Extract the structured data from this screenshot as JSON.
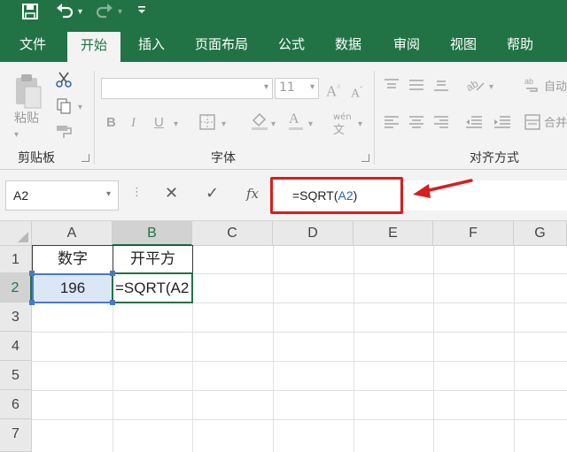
{
  "quick_access": {
    "save_icon": "save-icon",
    "undo_icon": "undo-icon",
    "redo_icon": "redo-icon",
    "customize_icon": "customize-qat-icon"
  },
  "ribbon_tabs": [
    {
      "label": "文件",
      "active": false
    },
    {
      "label": "开始",
      "active": true
    },
    {
      "label": "插入",
      "active": false
    },
    {
      "label": "页面布局",
      "active": false
    },
    {
      "label": "公式",
      "active": false
    },
    {
      "label": "数据",
      "active": false
    },
    {
      "label": "审阅",
      "active": false
    },
    {
      "label": "视图",
      "active": false
    },
    {
      "label": "帮助",
      "active": false
    }
  ],
  "ribbon": {
    "clipboard": {
      "paste_label": "粘贴",
      "group_label": "剪贴板"
    },
    "font": {
      "font_name": "",
      "font_size": "11",
      "group_label": "字体",
      "phonetic_label": "wén"
    },
    "alignment": {
      "group_label": "对齐方式",
      "wrap_label": "自动",
      "merge_label": "合并"
    }
  },
  "formula_bar": {
    "name_box": "A2",
    "cancel_symbol": "✕",
    "enter_symbol": "✓",
    "fx_label": "fx",
    "formula_prefix": "=SQRT(",
    "formula_ref": "A2",
    "formula_suffix": ")"
  },
  "annotation": {
    "highlight_color": "#d81e1e"
  },
  "sheet": {
    "columns": [
      "A",
      "B",
      "C",
      "D",
      "E",
      "F",
      "G"
    ],
    "rows": [
      "1",
      "2",
      "3",
      "4",
      "5",
      "6",
      "7"
    ],
    "selected_column": "B",
    "selected_row": "2",
    "cells": {
      "A1": "数字",
      "B1": "开平方",
      "A2": "196",
      "B2": "=SQRT(A2"
    }
  },
  "colors": {
    "accent": "#217346",
    "reference_blue": "#4a78c8"
  }
}
